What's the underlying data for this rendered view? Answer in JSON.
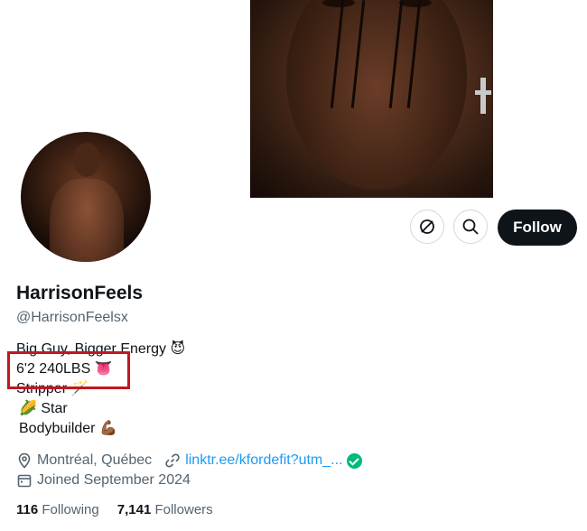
{
  "profile": {
    "display_name": "HarrisonFeels",
    "handle": "@HarrisonFeelsx",
    "follow_label": "Follow"
  },
  "bio": {
    "line1": "Big Guy, Bigger Energy 😈",
    "line2": "6'2 240LBS 👅",
    "line3": "Stripper 🪄",
    "line4": "🌽 Star",
    "line5": "Bodybuilder 💪🏾"
  },
  "meta": {
    "location": "Montréal, Québec",
    "link": "linktr.ee/kfordefit?utm_...",
    "joined": "Joined September 2024"
  },
  "stats": {
    "following_count": "116",
    "following_label": "Following",
    "followers_count": "7,141",
    "followers_label": "Followers"
  },
  "colors": {
    "text_primary": "#0f1419",
    "text_secondary": "#536471",
    "link": "#1d9bf0",
    "verified": "#00ba7c",
    "highlight_box": "#c2171f"
  },
  "icons": [
    "grok-icon",
    "search-icon",
    "location-icon",
    "link-icon",
    "calendar-icon",
    "verified-badge-icon"
  ]
}
